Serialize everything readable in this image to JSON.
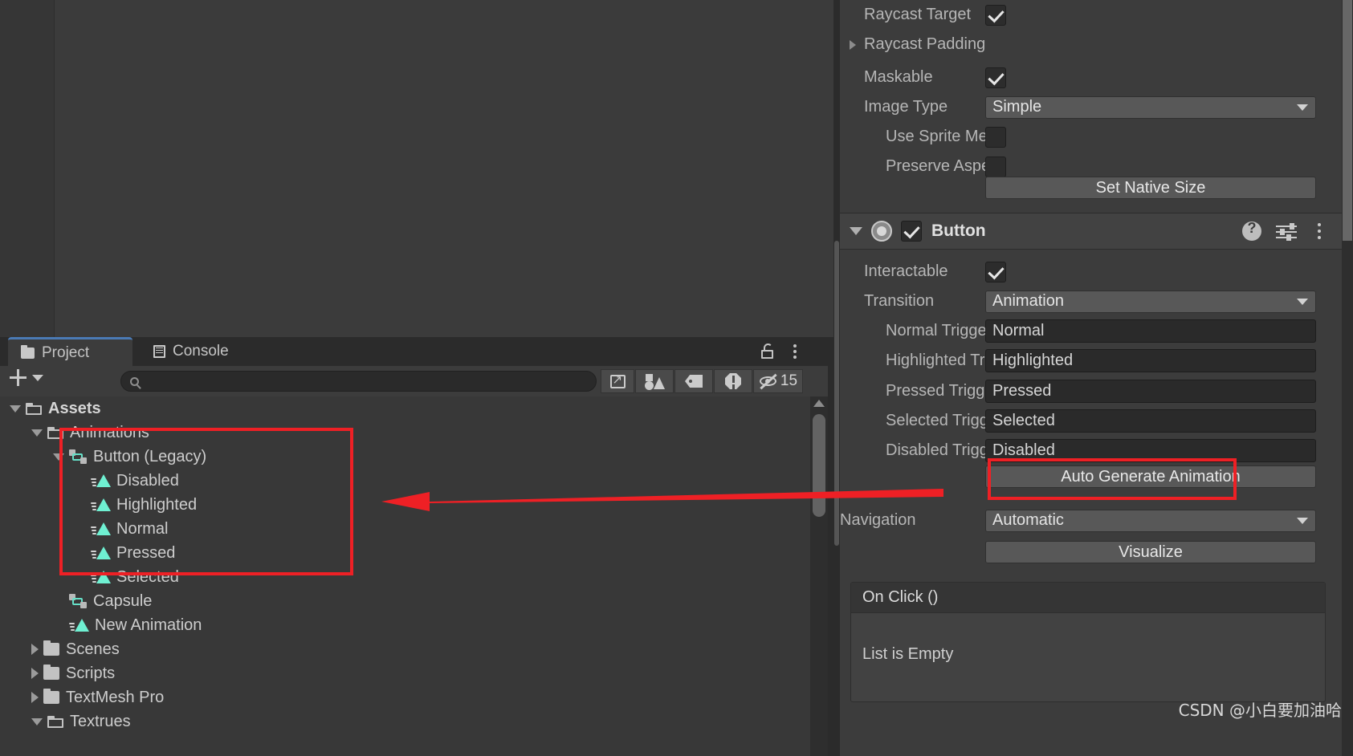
{
  "scene": {
    "name": "scene-view"
  },
  "project": {
    "tabs": [
      {
        "label": "Project",
        "icon": "folder-icon",
        "active": true
      },
      {
        "label": "Console",
        "icon": "console-icon",
        "active": false
      }
    ],
    "lock_icon": "lock-icon",
    "menu_icon": "kebab-menu-icon",
    "add_label": "+",
    "search": {
      "value": "",
      "placeholder": ""
    },
    "filters": [
      {
        "name": "save-search-icon"
      },
      {
        "name": "type-filter-icon"
      },
      {
        "name": "label-filter-icon"
      },
      {
        "name": "error-filter-icon"
      }
    ],
    "hidden_items_count": "15",
    "tree": [
      {
        "label": "Assets",
        "depth": 0,
        "twisty": "down",
        "icon": "folder-open-icon",
        "bold": true
      },
      {
        "label": "Animations",
        "depth": 1,
        "twisty": "down",
        "icon": "folder-open-icon",
        "bold": false
      },
      {
        "label": "Button (Legacy)",
        "depth": 2,
        "twisty": "down",
        "icon": "animator-controller-icon",
        "bold": false
      },
      {
        "label": "Disabled",
        "depth": 3,
        "twisty": "none",
        "icon": "animation-clip-icon",
        "bold": false
      },
      {
        "label": "Highlighted",
        "depth": 3,
        "twisty": "none",
        "icon": "animation-clip-icon",
        "bold": false
      },
      {
        "label": "Normal",
        "depth": 3,
        "twisty": "none",
        "icon": "animation-clip-icon",
        "bold": false
      },
      {
        "label": "Pressed",
        "depth": 3,
        "twisty": "none",
        "icon": "animation-clip-icon",
        "bold": false
      },
      {
        "label": "Selected",
        "depth": 3,
        "twisty": "none",
        "icon": "animation-clip-icon",
        "bold": false
      },
      {
        "label": "Capsule",
        "depth": 2,
        "twisty": "none",
        "icon": "animator-controller-icon",
        "bold": false
      },
      {
        "label": "New Animation",
        "depth": 2,
        "twisty": "none",
        "icon": "animation-clip-icon",
        "bold": false
      },
      {
        "label": "Scenes",
        "depth": 1,
        "twisty": "right",
        "icon": "folder-closed-icon",
        "bold": false
      },
      {
        "label": "Scripts",
        "depth": 1,
        "twisty": "right",
        "icon": "folder-closed-icon",
        "bold": false
      },
      {
        "label": "TextMesh Pro",
        "depth": 1,
        "twisty": "right",
        "icon": "folder-closed-icon",
        "bold": false
      },
      {
        "label": "Textrues",
        "depth": 1,
        "twisty": "down",
        "icon": "folder-open-icon",
        "bold": false
      }
    ]
  },
  "inspector": {
    "image_component": {
      "rows": [
        {
          "label": "Raycast Target",
          "kind": "checkbox",
          "value": "on",
          "indent": 0,
          "twisty": "none"
        },
        {
          "label": "Raycast Padding",
          "kind": "foldout",
          "value": "",
          "indent": 0,
          "twisty": "right"
        },
        {
          "label": "Maskable",
          "kind": "checkbox",
          "value": "on",
          "indent": 0,
          "twisty": "none"
        },
        {
          "label": "Image Type",
          "kind": "dropdown",
          "value": "Simple",
          "indent": 0,
          "twisty": "none"
        },
        {
          "label": "Use Sprite Mesh",
          "kind": "checkbox",
          "value": "off",
          "indent": 1,
          "twisty": "none"
        },
        {
          "label": "Preserve Aspect",
          "kind": "checkbox",
          "value": "off",
          "indent": 1,
          "twisty": "none"
        }
      ],
      "set_native_size_label": "Set Native Size"
    },
    "button_component": {
      "title": "Button",
      "enabled": "on",
      "header_icons": [
        "help-icon",
        "preset-icon",
        "kebab-menu-icon"
      ],
      "rows": [
        {
          "label": "Interactable",
          "kind": "checkbox",
          "value": "on",
          "indent": 0
        },
        {
          "label": "Transition",
          "kind": "dropdown",
          "value": "Animation",
          "indent": 0
        },
        {
          "label": "Normal Trigger",
          "kind": "textfield",
          "value": "Normal",
          "indent": 1
        },
        {
          "label": "Highlighted Trigge",
          "kind": "textfield",
          "value": "Highlighted",
          "indent": 1
        },
        {
          "label": "Pressed Trigger",
          "kind": "textfield",
          "value": "Pressed",
          "indent": 1
        },
        {
          "label": "Selected Trigger",
          "kind": "textfield",
          "value": "Selected",
          "indent": 1
        },
        {
          "label": "Disabled Trigger",
          "kind": "textfield",
          "value": "Disabled",
          "indent": 1
        }
      ],
      "auto_generate_label": "Auto Generate Animation",
      "navigation_label": "Navigation",
      "navigation_value": "Automatic",
      "visualize_label": "Visualize",
      "on_click": {
        "title": "On Click ()",
        "empty_text": "List is Empty"
      }
    }
  },
  "annotations": {
    "highlight_color": "#ee2025",
    "arrow": "points-left-from-auto-generate-to-animation-clips"
  },
  "watermark": "CSDN @小白要加油哈"
}
